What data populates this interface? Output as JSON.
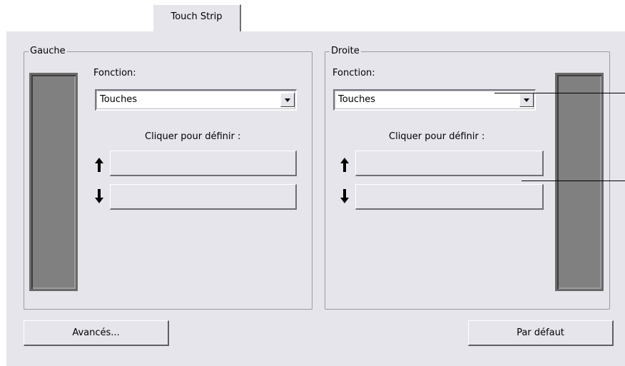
{
  "tabs": {
    "active": "Touch Strip"
  },
  "left": {
    "title": "Gauche",
    "function_label": "Fonction:",
    "function_value": "Touches",
    "define_label": "Cliquer pour définir :",
    "up_value": "",
    "down_value": ""
  },
  "right": {
    "title": "Droite",
    "function_label": "Fonction:",
    "function_value": "Touches",
    "define_label": "Cliquer pour définir :",
    "up_value": "",
    "down_value": ""
  },
  "buttons": {
    "advanced": "Avancés...",
    "default": "Par défaut"
  },
  "icons": {
    "up": "arrow-up-icon",
    "down": "arrow-down-icon",
    "dropdown": "chevron-down-icon"
  },
  "colors": {
    "background": "#e6e5ec",
    "strip": "#808080"
  }
}
